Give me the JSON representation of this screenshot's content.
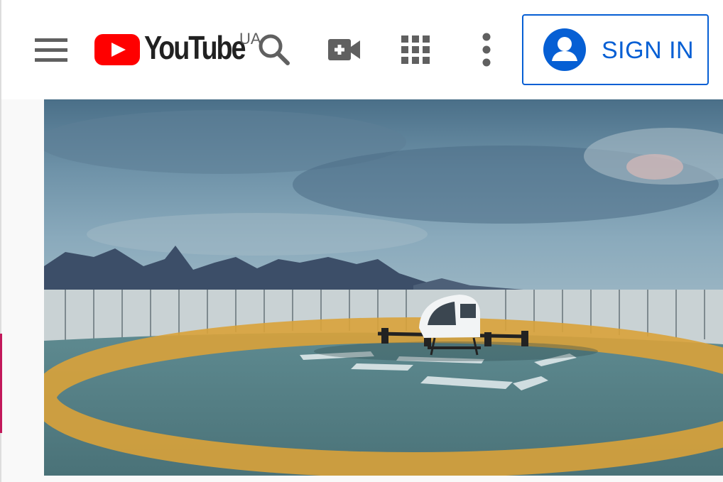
{
  "header": {
    "logo_text": "YouTube",
    "country_code": "UA",
    "signin_label": "SIGN IN"
  },
  "icons": {
    "menu": "hamburger-menu-icon",
    "search": "search-icon",
    "create": "video-camera-plus-icon",
    "apps": "apps-grid-icon",
    "more": "more-vertical-icon",
    "account": "account-circle-icon"
  },
  "colors": {
    "brand_red": "#ff0000",
    "link_blue": "#065fd4",
    "icon_gray": "#606060"
  }
}
